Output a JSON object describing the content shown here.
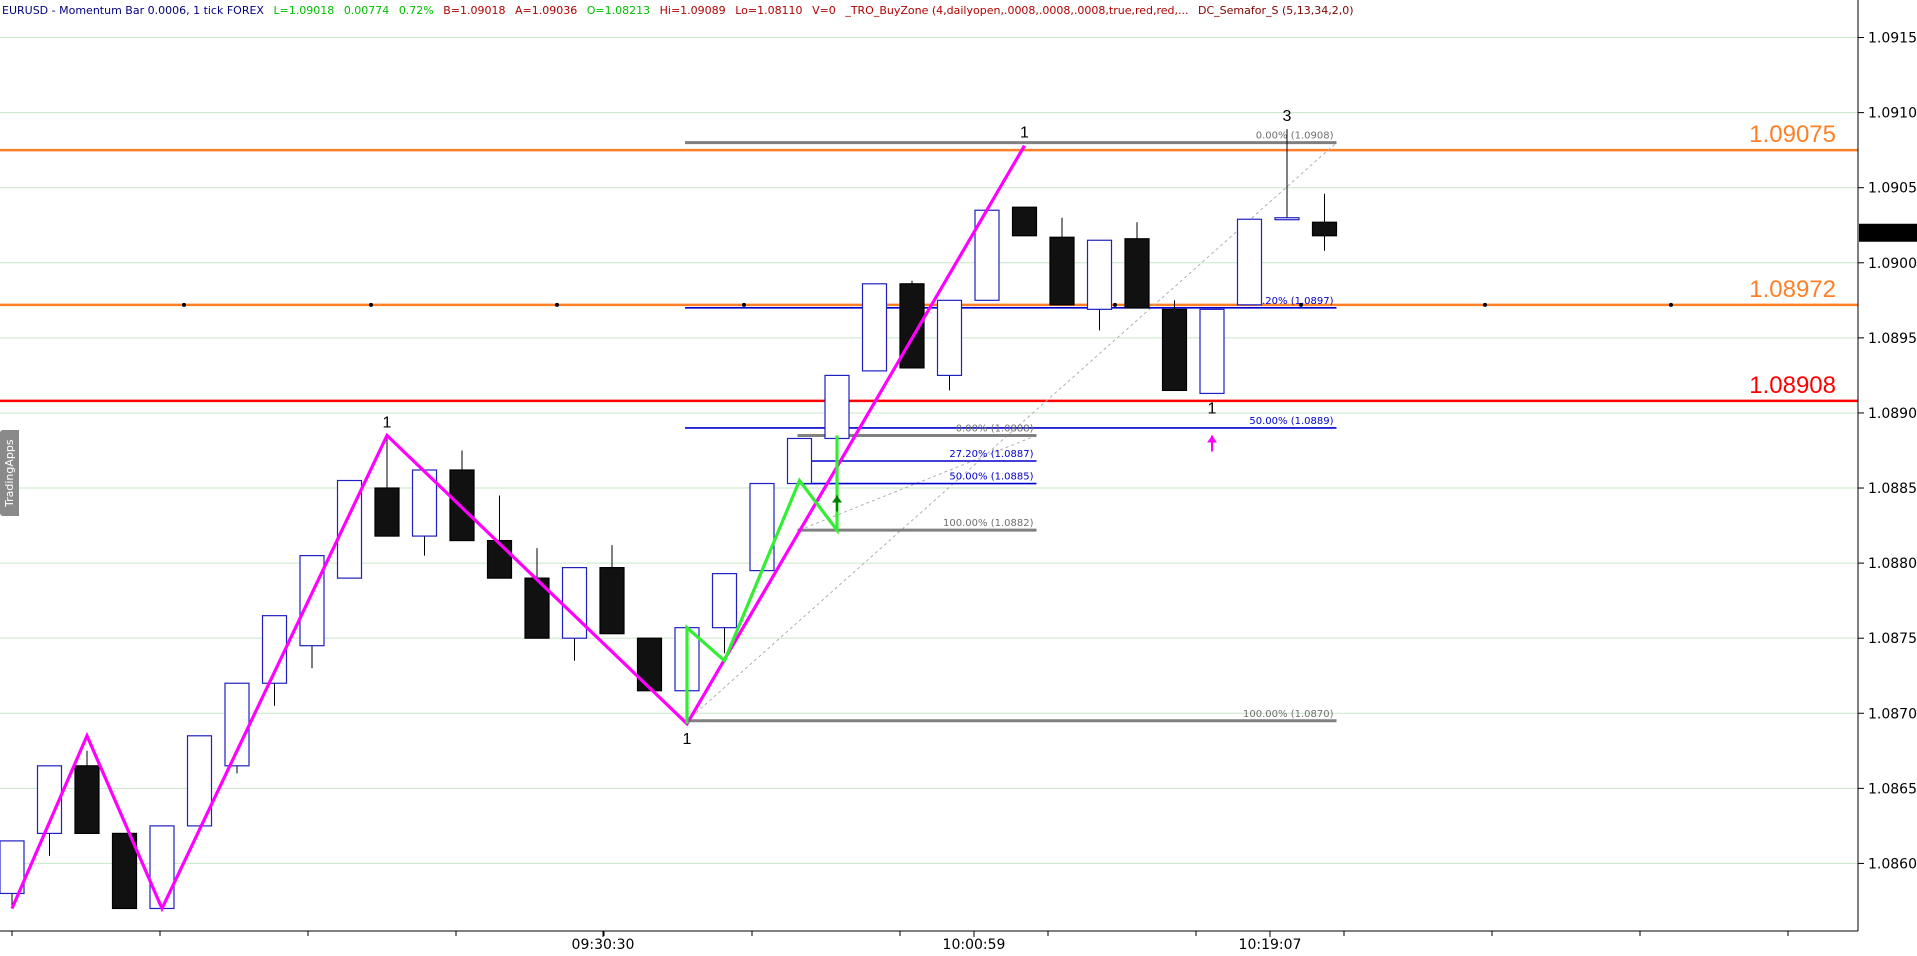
{
  "header": {
    "symbol": "EURUSD - Momentum Bar 0.0006, 1 tick  FOREX",
    "last": "L=1.09018",
    "change": "0.00774",
    "change_pct": "0.72%",
    "bid": "B=1.09018",
    "ask": "A=1.09036",
    "open": "O=1.08213",
    "high": "Hi=1.09089",
    "low": "Lo=1.08110",
    "volume": "V=0",
    "indicator1": "_TRO_BuyZone (4,dailyopen,.0008,.0008,.0008,true,red,red,...",
    "indicator2": "DC_Semafor_S (5,13,34,2,0)",
    "colors": {
      "symbol": "#00007f",
      "green": "#00c000",
      "red": "#b00000",
      "indicator2": "#7f0000"
    }
  },
  "side_tab": "TradingApps",
  "chart_data": {
    "type": "candlestick",
    "ylim": [
      1.08555,
      1.09175
    ],
    "y_ticks": [
      "1.0860",
      "1.0865",
      "1.0870",
      "1.0875",
      "1.0880",
      "1.0885",
      "1.0890",
      "1.0895",
      "1.0900",
      "1.0905",
      "1.0910",
      "1.0915"
    ],
    "x_ticks": [
      "09:30:30",
      "10:00:59",
      "10:19:07"
    ],
    "current_price": "1.0902",
    "candles": [
      {
        "o": 1.0858,
        "c": 1.08615,
        "h": 1.08615,
        "l": 1.0857
      },
      {
        "o": 1.0862,
        "c": 1.08665,
        "h": 1.08665,
        "l": 1.08605
      },
      {
        "o": 1.08665,
        "c": 1.0862,
        "h": 1.08675,
        "l": 1.0862
      },
      {
        "o": 1.0862,
        "c": 1.0857,
        "h": 1.0862,
        "l": 1.0857
      },
      {
        "o": 1.0857,
        "c": 1.08625,
        "h": 1.08625,
        "l": 1.0857
      },
      {
        "o": 1.08625,
        "c": 1.08685,
        "h": 1.08685,
        "l": 1.08625
      },
      {
        "o": 1.08665,
        "c": 1.0872,
        "h": 1.0872,
        "l": 1.0866
      },
      {
        "o": 1.0872,
        "c": 1.08765,
        "h": 1.08765,
        "l": 1.08705
      },
      {
        "o": 1.08745,
        "c": 1.08805,
        "h": 1.08805,
        "l": 1.0873
      },
      {
        "o": 1.0879,
        "c": 1.08855,
        "h": 1.08855,
        "l": 1.0879
      },
      {
        "o": 1.0885,
        "c": 1.08818,
        "h": 1.08885,
        "l": 1.08818
      },
      {
        "o": 1.08818,
        "c": 1.08862,
        "h": 1.08862,
        "l": 1.08805
      },
      {
        "o": 1.08862,
        "c": 1.08815,
        "h": 1.08875,
        "l": 1.08815
      },
      {
        "o": 1.08815,
        "c": 1.0879,
        "h": 1.08845,
        "l": 1.0879
      },
      {
        "o": 1.0879,
        "c": 1.0875,
        "h": 1.0881,
        "l": 1.0875
      },
      {
        "o": 1.0875,
        "c": 1.08797,
        "h": 1.08797,
        "l": 1.08735
      },
      {
        "o": 1.08797,
        "c": 1.08753,
        "h": 1.08812,
        "l": 1.08753
      },
      {
        "o": 1.0875,
        "c": 1.08715,
        "h": 1.0875,
        "l": 1.08715
      },
      {
        "o": 1.08715,
        "c": 1.08757,
        "h": 1.08757,
        "l": 1.08715
      },
      {
        "o": 1.08757,
        "c": 1.08793,
        "h": 1.08793,
        "l": 1.0874
      },
      {
        "o": 1.08795,
        "c": 1.08853,
        "h": 1.08853,
        "l": 1.08795
      },
      {
        "o": 1.08853,
        "c": 1.08883,
        "h": 1.08883,
        "l": 1.08853
      },
      {
        "o": 1.08883,
        "c": 1.08925,
        "h": 1.08925,
        "l": 1.08883
      },
      {
        "o": 1.08928,
        "c": 1.08986,
        "h": 1.08986,
        "l": 1.08928
      },
      {
        "o": 1.08986,
        "c": 1.0893,
        "h": 1.08988,
        "l": 1.0893
      },
      {
        "o": 1.08925,
        "c": 1.08975,
        "h": 1.08975,
        "l": 1.08915
      },
      {
        "o": 1.08975,
        "c": 1.09035,
        "h": 1.09035,
        "l": 1.08975
      },
      {
        "o": 1.09037,
        "c": 1.09018,
        "h": 1.09037,
        "l": 1.09018
      },
      {
        "o": 1.09017,
        "c": 1.08972,
        "h": 1.0903,
        "l": 1.08972
      },
      {
        "o": 1.08969,
        "c": 1.09015,
        "h": 1.09015,
        "l": 1.08955
      },
      {
        "o": 1.09016,
        "c": 1.0897,
        "h": 1.09027,
        "l": 1.0897
      },
      {
        "o": 1.08969,
        "c": 1.08915,
        "h": 1.08975,
        "l": 1.08915
      },
      {
        "o": 1.08913,
        "c": 1.08969,
        "h": 1.08969,
        "l": 1.08913
      },
      {
        "o": 1.08972,
        "c": 1.09029,
        "h": 1.09029,
        "l": 1.08972
      },
      {
        "o": 1.0903,
        "c": 1.0903,
        "h": 1.09089,
        "l": 1.0903
      },
      {
        "o": 1.09027,
        "c": 1.09018,
        "h": 1.09046,
        "l": 1.09008
      }
    ],
    "levels": [
      {
        "value": 1.09075,
        "label": "1.09075",
        "color": "#ff7f27"
      },
      {
        "value": 1.08972,
        "label": "1.08972",
        "color": "#ff7f27"
      },
      {
        "value": 1.08908,
        "label": "1.08908",
        "color": "#ff0000"
      }
    ],
    "zigzag": [
      [
        0,
        1.0857
      ],
      [
        2,
        1.08685
      ],
      [
        4,
        1.0857
      ],
      [
        10,
        1.08885
      ],
      [
        18,
        1.08693
      ],
      [
        27,
        1.09078
      ]
    ],
    "zigzag_color": "#ff00ff",
    "green_path": [
      [
        18,
        1.08693
      ],
      [
        18,
        1.08757
      ],
      [
        19,
        1.08735
      ],
      [
        21,
        1.08855
      ],
      [
        22,
        1.08822
      ],
      [
        22,
        1.08885
      ]
    ],
    "green_color": "#33ee33",
    "semafor": [
      {
        "i": 10,
        "price": 1.08885,
        "label": "1",
        "pos": "above"
      },
      {
        "i": 18,
        "price": 1.08693,
        "label": "1",
        "pos": "below"
      },
      {
        "i": 27,
        "price": 1.09078,
        "label": "1",
        "pos": "above"
      },
      {
        "i": 34,
        "price": 1.09089,
        "label": "3",
        "pos": "above"
      },
      {
        "i": 32,
        "price": 1.08913,
        "label": "1",
        "pos": "below"
      }
    ],
    "fib_sets": [
      {
        "x1": 18,
        "x2": 35,
        "color": "#888888",
        "lines": [
          {
            "price": 1.0908,
            "label": "0.00% (1.0908)",
            "gray": true
          },
          {
            "price": 1.0897,
            "label": "27.20% (1.0897)",
            "gray": false
          },
          {
            "price": 1.0889,
            "label": "50.00% (1.0889)",
            "gray": false
          },
          {
            "price": 1.08695,
            "label": "100.00% (1.0870)",
            "gray": true
          }
        ]
      },
      {
        "x1": 21,
        "x2": 27,
        "color": "#888888",
        "lines": [
          {
            "price": 1.08885,
            "label": "0.00% (1.0888)",
            "gray": true
          },
          {
            "price": 1.08868,
            "label": "27.20% (1.0887)",
            "gray": false
          },
          {
            "price": 1.08853,
            "label": "50.00% (1.0885)",
            "gray": false
          },
          {
            "price": 1.08822,
            "label": "100.00% (1.0882)",
            "gray": true
          }
        ]
      }
    ],
    "arrows": [
      {
        "i": 22,
        "price": 1.08845,
        "color": "#008000"
      },
      {
        "i": 32,
        "price": 1.08885,
        "color": "#ff00ff"
      }
    ]
  }
}
